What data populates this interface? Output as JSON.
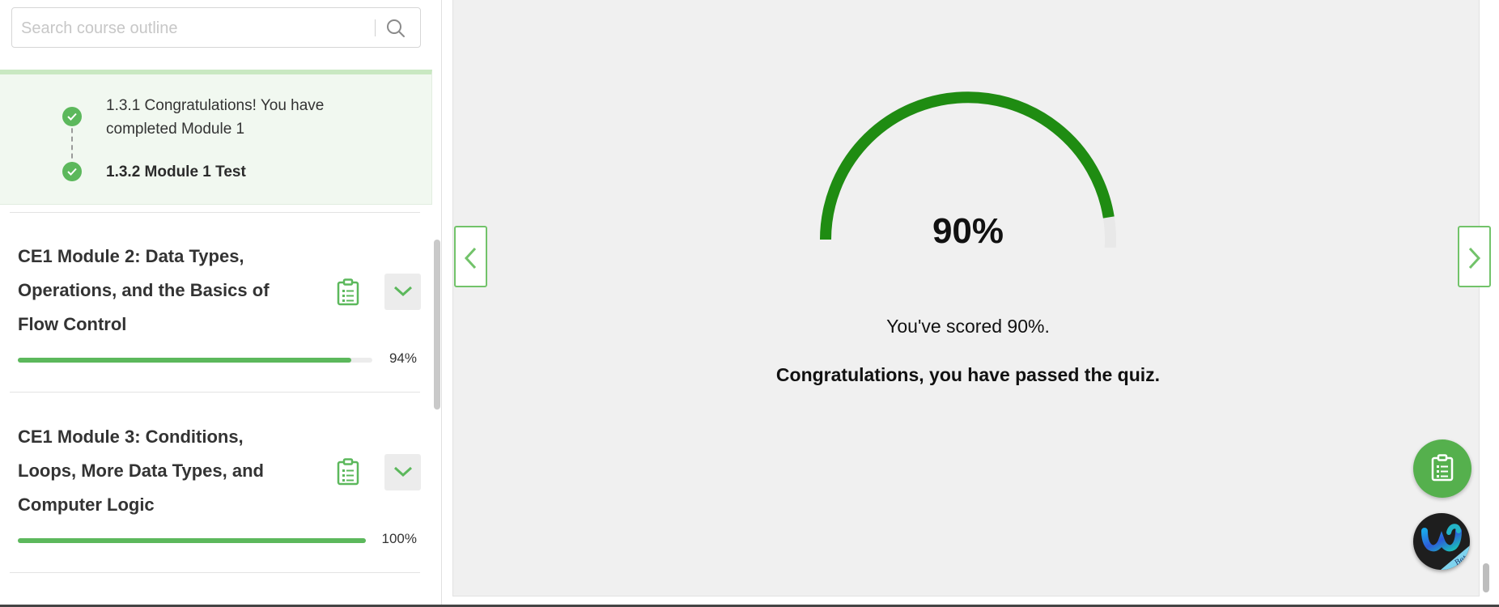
{
  "search": {
    "placeholder": "Search course outline",
    "value": ""
  },
  "lessons": [
    {
      "label": "1.3.1 Congratulations! You have completed Module 1",
      "status": "completed"
    },
    {
      "label": "1.3.2 Module 1 Test",
      "status": "completed",
      "current": true
    }
  ],
  "modules": [
    {
      "title": "CE1 Module 2: Data Types, Operations, and the Basics of Flow Control",
      "progress": 94,
      "progress_label": "94%",
      "expanded": false
    },
    {
      "title": "CE1 Module 3: Conditions, Loops, More Data Types, and Computer Logic",
      "progress": 100,
      "progress_label": "100%",
      "expanded": false
    }
  ],
  "quiz": {
    "score": 90,
    "score_label": "90%",
    "scored_text": "You've scored 90%.",
    "passed_text": "Congratulations, you have passed the quiz."
  },
  "colors": {
    "gauge": "#1f8c12",
    "progress": "#5cb85c",
    "accent": "#72c36a",
    "check": "#5cb85c"
  },
  "icons": {
    "search": "search-icon",
    "module_resource": "clipboard-list-icon",
    "expand": "chevron-down-icon",
    "prev": "chevron-left-icon",
    "next": "chevron-right-icon",
    "assistant": "webex-assistant-icon",
    "assistant_badge": "Beta"
  }
}
